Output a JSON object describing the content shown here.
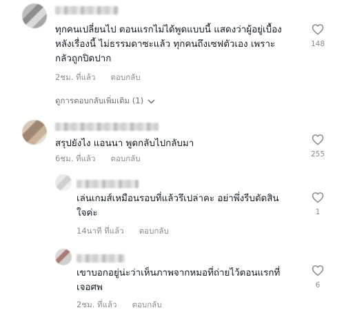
{
  "comments": [
    {
      "text": "ทุกคนเปลี่ยนไป ตอนแรกไม่ได้พูดแบบนี้ แสดงว่าผู้อยู่เบื้อง\nหลังเรื่องนี้ ไม่ธรรมดาซะแล้ว ทุกคนถึงเซฟตัวเอง เพราะ\nกลัวถูกปิดปาก",
      "time": "2ชม. ที่แล้ว",
      "reply_label": "ตอบกลับ",
      "likes": "148"
    },
    {
      "text": "สรุปยังไง แอนนา พูดกลับไปกลับมา",
      "time": "6ชม. ที่แล้ว",
      "reply_label": "ตอบกลับ",
      "likes": "255"
    }
  ],
  "view_more_replies": "ดูการตอบกลับเพิ่มเติม (1)",
  "replies": [
    {
      "text": "เล่นเกมส์เหมือนรอบที่แล้วรึเปล่าคะ อย่าพึ่งรีบตัดสิน\nใจค่ะ",
      "time": "14นาที ที่แล้ว",
      "reply_label": "ตอบกลับ",
      "likes": "1"
    },
    {
      "text": "เขาบอกอยู่น่ะว่าเห็นภาพจากหมอที่ถ่ายไว้ตอนแรกที่\nเจอศพ",
      "time": "2ชม. ที่แล้ว",
      "reply_label": "ตอบกลับ",
      "likes": "6"
    }
  ],
  "icons": {
    "like": "heart-outline-icon",
    "expand": "chevron-down-icon"
  },
  "colors": {
    "text": "#161823",
    "meta": "#8a8b91",
    "icon": "#8a8b91"
  }
}
